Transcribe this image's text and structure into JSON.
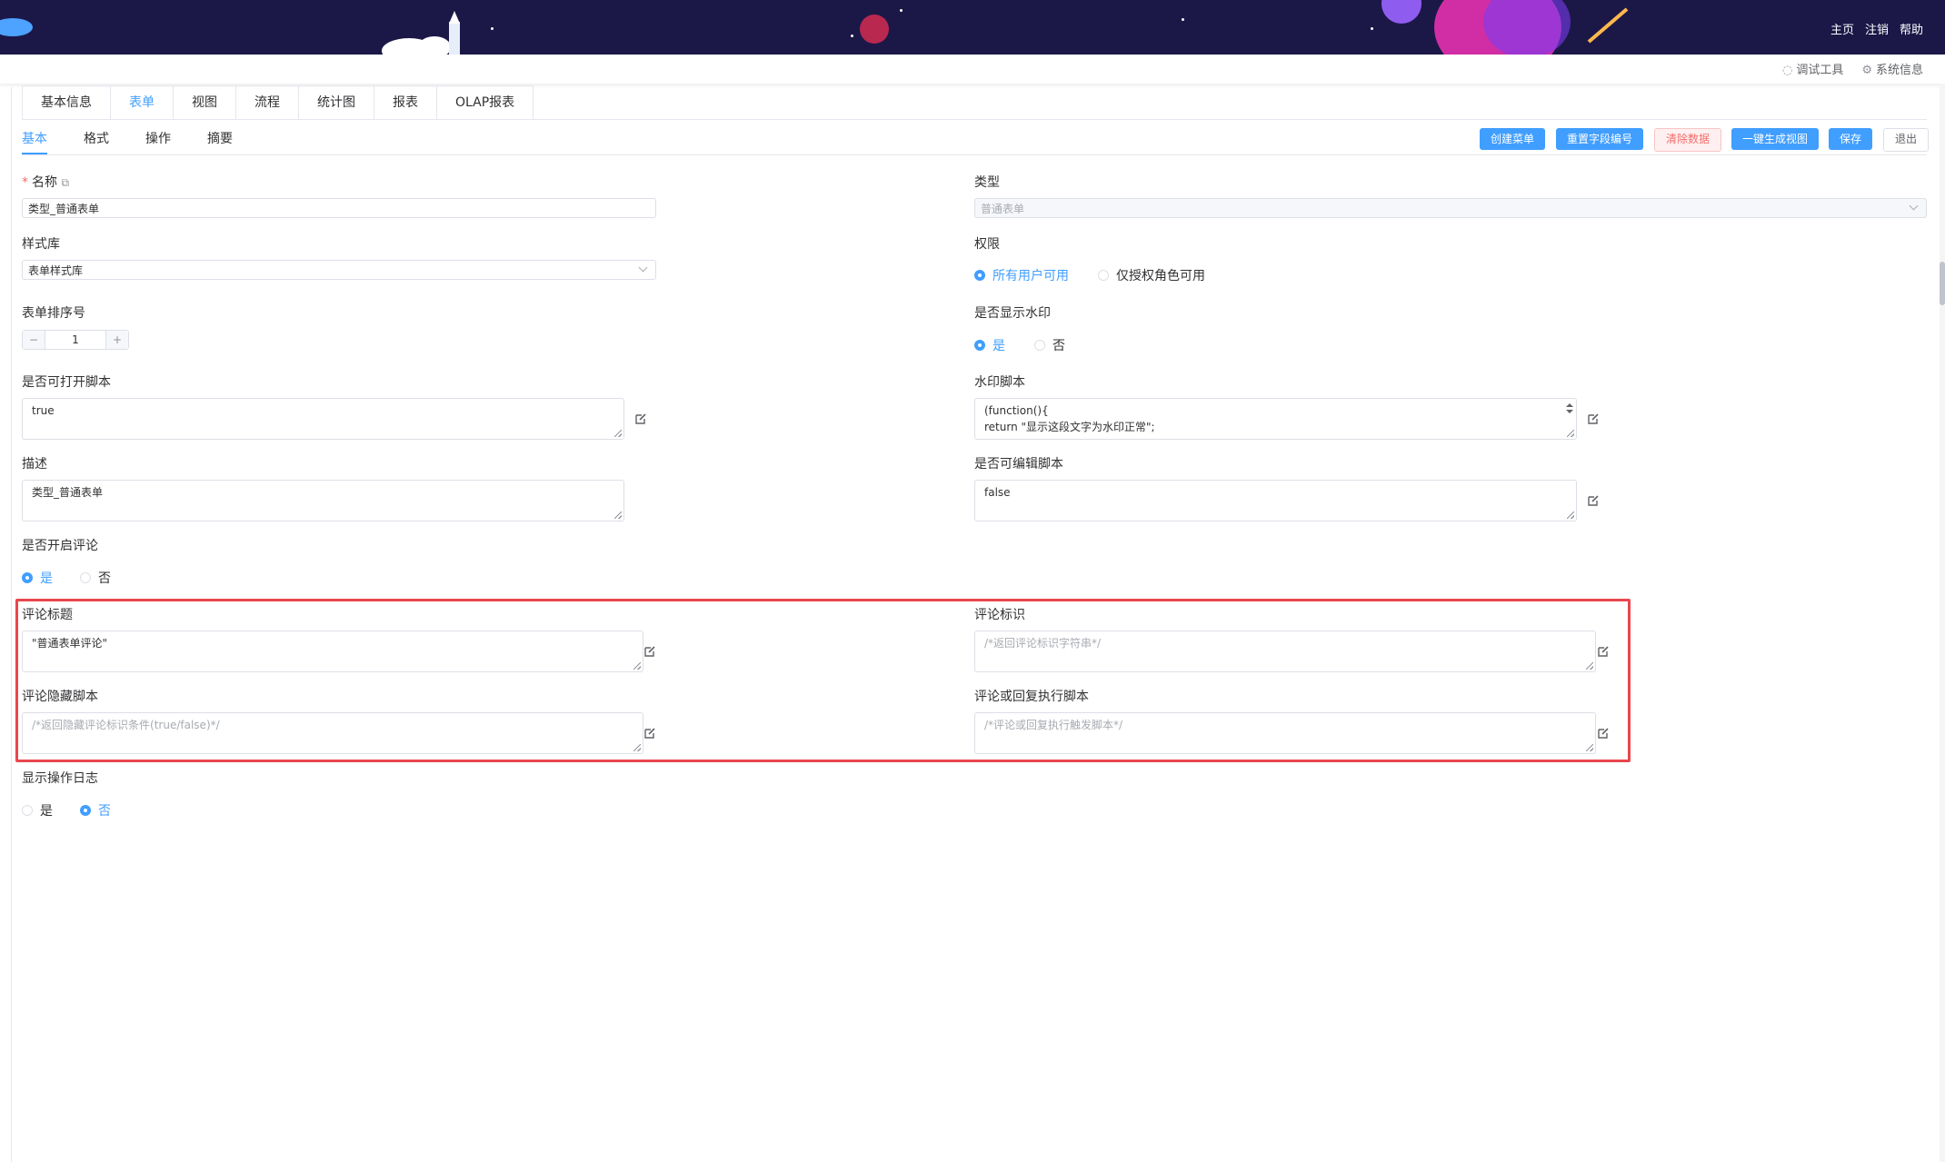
{
  "header": {
    "nav": [
      "主页",
      "注销",
      "帮助"
    ],
    "tools": [
      {
        "icon": "debug-icon",
        "label": "调试工具"
      },
      {
        "icon": "gear-icon",
        "label": "系统信息"
      }
    ]
  },
  "main_tabs": [
    "基本信息",
    "表单",
    "视图",
    "流程",
    "统计图",
    "报表",
    "OLAP报表"
  ],
  "active_main_tab": "表单",
  "sub_tabs": [
    "基本",
    "格式",
    "操作",
    "摘要"
  ],
  "active_sub_tab": "基本",
  "actions": {
    "create_menu": "创建菜单",
    "reset_field_no": "重置字段编号",
    "clear_data": "清除数据",
    "generate_view": "一键生成视图",
    "save": "保存",
    "exit": "退出"
  },
  "form": {
    "name": {
      "label": "名称",
      "value": "类型_普通表单"
    },
    "type": {
      "label": "类型",
      "value": "普通表单"
    },
    "style_lib": {
      "label": "样式库",
      "value": "表单样式库"
    },
    "permission": {
      "label": "权限",
      "options": [
        "所有用户可用",
        "仅授权角色可用"
      ],
      "selected": "所有用户可用"
    },
    "sort_no": {
      "label": "表单排序号",
      "value": "1",
      "minus": "−",
      "plus": "+"
    },
    "watermark_show": {
      "label": "是否显示水印",
      "options": [
        "是",
        "否"
      ],
      "selected": "是"
    },
    "open_script": {
      "label": "是否可打开脚本",
      "value": "true"
    },
    "watermark_script": {
      "label": "水印脚本",
      "value": "(function(){\nreturn \"显示这段文字为水印正常\";"
    },
    "description": {
      "label": "描述",
      "value": "类型_普通表单"
    },
    "edit_script": {
      "label": "是否可编辑脚本",
      "value": "false"
    },
    "comment_enabled": {
      "label": "是否开启评论",
      "options": [
        "是",
        "否"
      ],
      "selected": "是"
    },
    "comment_title": {
      "label": "评论标题",
      "value": "\"普通表单评论\""
    },
    "comment_id": {
      "label": "评论标识",
      "placeholder": "/*返回评论标识字符串*/"
    },
    "comment_hide_script": {
      "label": "评论隐藏脚本",
      "placeholder": "/*返回隐藏评论标识条件(true/false)*/"
    },
    "comment_reply_script": {
      "label": "评论或回复执行脚本",
      "placeholder": "/*评论或回复执行触发脚本*/"
    },
    "show_log": {
      "label": "显示操作日志",
      "options": [
        "是",
        "否"
      ],
      "selected": "否"
    }
  },
  "colors": {
    "primary": "#409eff",
    "danger": "#f56c6c",
    "highlight_box": "#e8474d",
    "banner": "#1b1848"
  }
}
